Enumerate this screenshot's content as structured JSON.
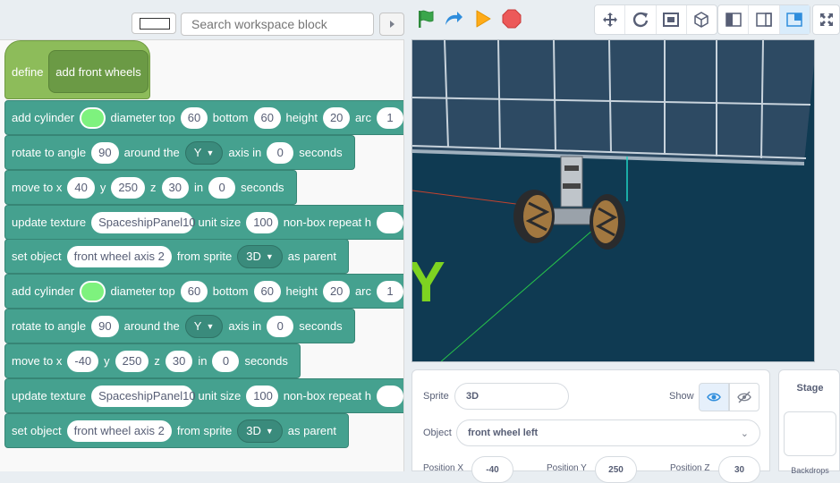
{
  "toolbar": {
    "search_placeholder": "Search workspace block",
    "colors": {
      "flag": "#3aa64b",
      "turbo": "#2f8ddc",
      "go": "#ffab19",
      "stop": "#ec5959"
    }
  },
  "workspace": {
    "define": {
      "keyword": "define",
      "name": "add front wheels"
    },
    "blocks": [
      {
        "type": "add-cylinder",
        "t0": "add cylinder",
        "t1": "diameter top",
        "v1": "60",
        "t2": "bottom",
        "v2": "60",
        "t3": "height",
        "v3": "20",
        "t4": "arc",
        "v4": "1"
      },
      {
        "type": "rotate",
        "t0": "rotate to angle",
        "v1": "90",
        "t1": "around the",
        "axis": "Y",
        "t2": "axis in",
        "v2": "0",
        "t3": "seconds"
      },
      {
        "type": "move",
        "t0": "move to x",
        "x": "40",
        "ty": "y",
        "y": "250",
        "tz": "z",
        "z": "30",
        "tin": "in",
        "secs": "0",
        "t3": "seconds"
      },
      {
        "type": "texture",
        "t0": "update texture",
        "tex": "SpaceshipPanel10",
        "t1": "unit size",
        "v1": "100",
        "t2": "non-box repeat h",
        "v2": ""
      },
      {
        "type": "parent",
        "t0": "set object",
        "obj": "front wheel axis 2",
        "t1": "from sprite",
        "sprite": "3D",
        "t2": "as parent"
      },
      {
        "type": "add-cylinder",
        "t0": "add cylinder",
        "t1": "diameter top",
        "v1": "60",
        "t2": "bottom",
        "v2": "60",
        "t3": "height",
        "v3": "20",
        "t4": "arc",
        "v4": "1"
      },
      {
        "type": "rotate",
        "t0": "rotate to angle",
        "v1": "90",
        "t1": "around the",
        "axis": "Y",
        "t2": "axis in",
        "v2": "0",
        "t3": "seconds"
      },
      {
        "type": "move",
        "t0": "move to x",
        "x": "-40",
        "ty": "y",
        "y": "250",
        "tz": "z",
        "z": "30",
        "tin": "in",
        "secs": "0",
        "t3": "seconds"
      },
      {
        "type": "texture",
        "t0": "update texture",
        "tex": "SpaceshipPanel10",
        "t1": "unit size",
        "v1": "100",
        "t2": "non-box repeat h",
        "v2": ""
      },
      {
        "type": "parent",
        "t0": "set object",
        "obj": "front wheel axis 2",
        "t1": "from sprite",
        "sprite": "3D",
        "t2": "as parent"
      }
    ],
    "block_color": "#45a18f",
    "define_color": "#8dbc5a"
  },
  "stage": {
    "axis_label": "Y"
  },
  "sprite_panel": {
    "sprite_label": "Sprite",
    "sprite_value": "3D",
    "show_label": "Show",
    "object_label": "Object",
    "object_value": "front wheel left",
    "pos_x_label": "Position X",
    "pos_x_value": "-40",
    "pos_y_label": "Position Y",
    "pos_y_value": "250",
    "pos_z_label": "Position Z",
    "pos_z_value": "30"
  },
  "stage_panel": {
    "title": "Stage",
    "backdrops_label": "Backdrops"
  }
}
